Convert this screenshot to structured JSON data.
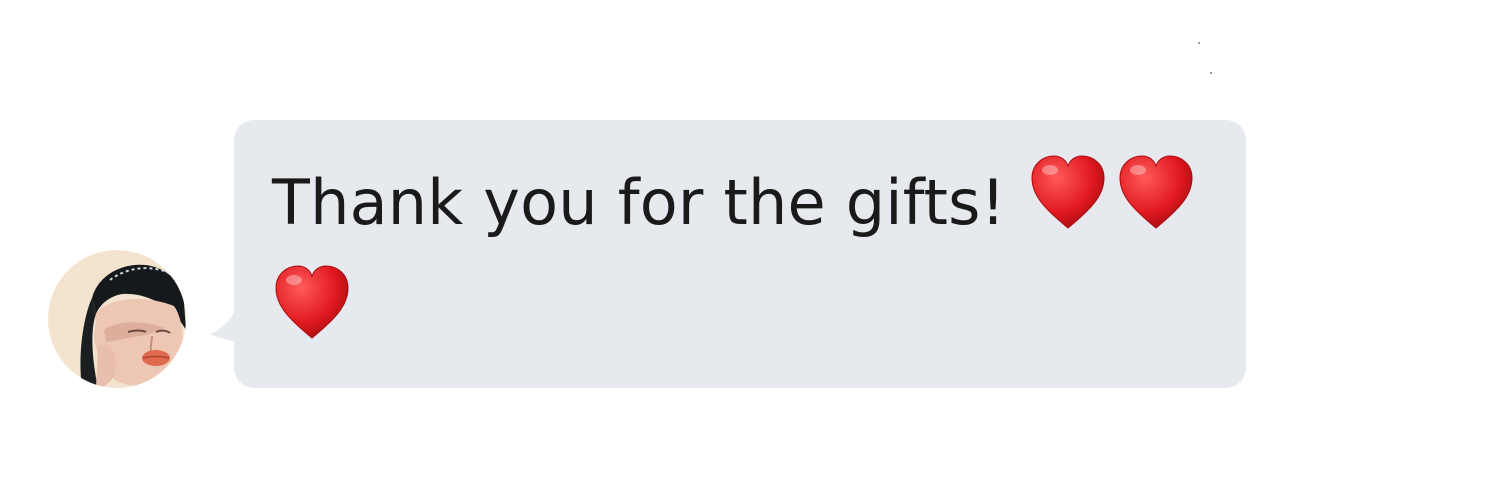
{
  "message": {
    "text": "Thank you for the gifts!",
    "emoji": [
      "red-heart",
      "red-heart",
      "red-heart"
    ]
  },
  "colors": {
    "bubble_background": "#e6eaef",
    "text": "#1a1a1a",
    "heart": "#e0191f"
  },
  "sender": {
    "avatar_icon": "user-avatar-photo"
  }
}
